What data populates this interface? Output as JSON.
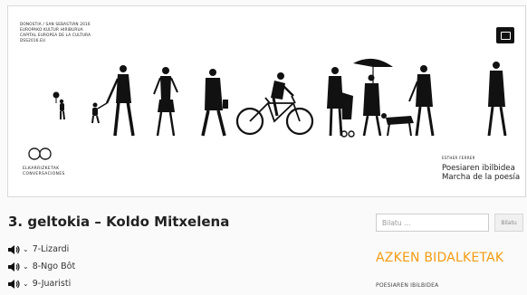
{
  "banner": {
    "lines": [
      "DONOSTIA / SAN SEBASTIÁN 2016",
      "EUROPAKO KULTUR HIRIBURUA",
      "CAPITAL EUROPEA DE LA CULTURA",
      "DSS2016.EU"
    ],
    "elkar_line1": "ELKARRIZKETAK",
    "elkar_line2": "CONVERSACIONES",
    "author": "ESTHER FERRER",
    "route_line1": "Poesiaren ibilbidea",
    "route_line2": "Marcha de la poesía"
  },
  "main": {
    "title": "3. geltokia – Koldo Mitxelena",
    "tracks": [
      {
        "label": "7-Lizardi"
      },
      {
        "label": "8-Ngo Bôt"
      },
      {
        "label": "9-Juaristi"
      }
    ]
  },
  "sidebar": {
    "search_placeholder": "Bilatu …",
    "search_button": "Bilatu",
    "widget_title": "AZKEN BIDALKETAK",
    "recent": [
      "POESIAREN IBILBIDEA"
    ]
  },
  "colors": {
    "accent": "#f39c12",
    "text": "#222222",
    "background": "#fafafa"
  },
  "icons": [
    "speaker-icon",
    "chevron-down-icon",
    "camera-logo-icon",
    "infinity-icon"
  ]
}
